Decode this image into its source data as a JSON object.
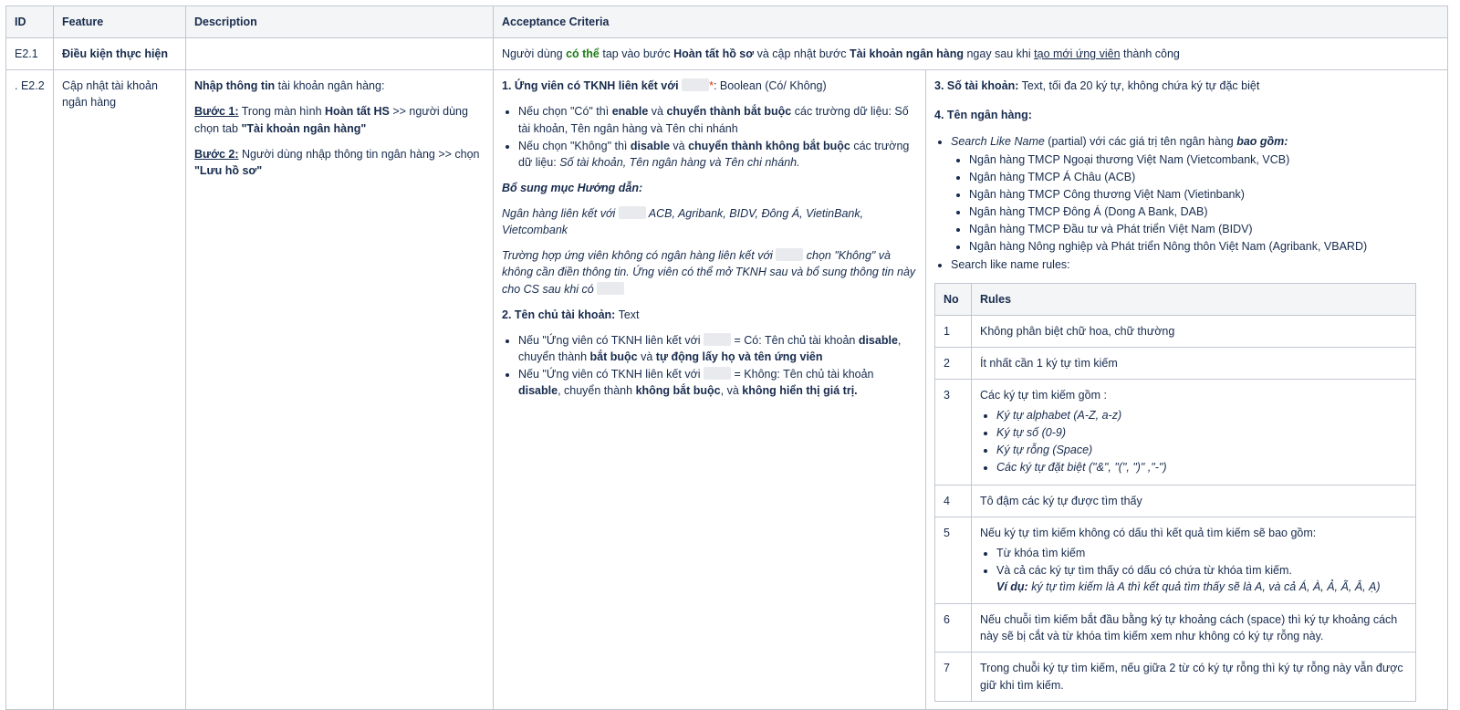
{
  "headers": {
    "id": "ID",
    "feature": "Feature",
    "description": "Description",
    "acceptance": "Acceptance Criteria"
  },
  "row1": {
    "id": "E2.1",
    "feature": "Điều kiện thực hiện",
    "ac": {
      "p1": "Người dùng ",
      "p2": "có thể",
      "p3": " tap vào bước ",
      "p4": "Hoàn tất hồ sơ",
      "p5": " và cập nhật bước ",
      "p6": "Tài khoản ngân hàng",
      "p7": " ngay sau khi ",
      "p8": "tạo mới ứng viên",
      "p9": " thành công"
    }
  },
  "row2": {
    "id": ". E2.2",
    "feature": "Cập nhật tài khoản ngân hàng",
    "desc": {
      "l1b": "Nhập thông tin",
      "l1": " tài khoản ngân hàng:",
      "s1u": "Bước 1:",
      "s1a": " Trong màn hình ",
      "s1b": "Hoàn tất HS",
      "s1c": " >> người dùng chọn tab ",
      "s1d": "\"Tài khoản ngân hàng\"",
      "s2u": "Bước 2:",
      "s2a": " Người dùng nhập thông tin ngân hàng >> chọn ",
      "s2b": "\"Lưu hồ sơ\""
    },
    "c3": {
      "h1a": "1. Ứng viên có TKNH liên kết với ",
      "h1star": "*",
      "h1b": ": Boolean (Có/ Không)",
      "b1a": "Nếu chọn \"Có\" thì ",
      "b1b": "enable",
      "b1c": " và ",
      "b1d": "chuyển thành bắt buộc",
      "b1e": " các trường dữ liệu: Số tài khoản, Tên ngân hàng và Tên chi nhánh",
      "b2a": "Nếu chọn \"Không\" thì ",
      "b2b": "disable",
      "b2c": " và ",
      "b2d": "chuyển thành không bắt buộc",
      "b2e": " các trường dữ liệu: ",
      "b2f": "Số tài khoản, Tên ngân hàng và Tên chi nhánh.",
      "guideTitle": "Bổ sung mục Hướng dẫn:",
      "g1a": "Ngân hàng liên kết với ",
      "g1b": " ACB, Agribank, BIDV, Đông Á, VietinBank, Vietcombank",
      "g2a": "Trường hợp ứng viên không có ngân hàng liên kết với ",
      "g2b": " chọn \"Không\" và không cần điền thông tin. Ứng viên có thể mở TKNH sau và bổ sung thông tin này cho CS sau khi có ",
      "h2a": "2. Tên chủ tài khoản:",
      "h2b": " Text",
      "t1a": "Nếu \"Ứng viên có TKNH liên kết với ",
      "t1b": " = Có: Tên chủ tài khoản ",
      "t1c": "disable",
      "t1d": ", chuyển thành ",
      "t1e": "bắt buộc",
      "t1f": " và ",
      "t1g": "tự động lấy họ và tên ứng viên",
      "t2a": "Nếu \"Ứng viên có TKNH liên kết với ",
      "t2b": " = Không: Tên chủ tài khoản ",
      "t2c": "disable",
      "t2d": ", chuyển thành ",
      "t2e": "không bắt buộc",
      "t2f": ", và ",
      "t2g": "không hiển thị giá trị."
    },
    "c4": {
      "h3a": "3. Số tài khoản:",
      "h3b": " Text, tối đa 20 ký tự, không chứa ký tự đặc biệt",
      "h4": "4. Tên ngân hàng:",
      "sl1": "Search Like Name",
      "sl2": " (partial) với các giá trị tên ngân hàng ",
      "sl3": "bao gồm:",
      "banks": [
        "Ngân hàng TMCP Ngoại thương Việt Nam (Vietcombank, VCB)",
        "Ngân hàng TMCP Á Châu (ACB)",
        "Ngân hàng TMCP Công thương Việt Nam (Vietinbank)",
        "Ngân hàng TMCP Đông Á (Dong A Bank, DAB)",
        "Ngân hàng TMCP Đầu tư và Phát triển Việt Nam (BIDV)",
        "Ngân hàng Nông nghiệp và Phát triển Nông thôn Việt Nam (Agribank, VBARD)"
      ],
      "rulesLabel": "Search like name rules:",
      "rulesHead": {
        "no": "No",
        "rules": "Rules"
      },
      "r1": "Không phân biệt chữ hoa, chữ thường",
      "r2": "Ít nhất cần 1 ký tự tìm kiếm",
      "r3": "Các ký tự tìm kiếm gồm :",
      "r3items": [
        "Ký tự alphabet (A-Z, a-z)",
        "Ký tự số (0-9)",
        "Ký tự rỗng (Space)",
        "Các ký tự đặt biệt (\"&\", \"(\", \")\" ,\"-\")"
      ],
      "r4": "Tô đậm các ký tự được tìm thấy",
      "r5": "Nếu ký tự tìm kiếm không có dấu thì kết quả tìm kiếm sẽ bao gồm:",
      "r5a": "Từ khóa tìm kiếm",
      "r5b": "Và cả các ký tự tìm thấy có dấu có chứa từ khóa tìm kiếm.",
      "r5c": "Ví dụ:",
      "r5d": " ký tự tìm kiếm là A thì kết quả tìm thấy sẽ là A, và cả Á, À, Ả, Ã, Â, Ạ)",
      "r6": "Nếu chuỗi tìm kiếm bắt đầu bằng ký tự khoảng cách (space) thì ký tự khoảng cách này sẽ bị cắt và từ khóa tìm kiếm xem như không có ký tự rỗng này.",
      "r7": "Trong chuỗi ký tự tìm kiếm, nếu giữa 2 từ có ký tự rỗng thì ký tự rỗng này vẫn được giữ khi tìm kiếm.",
      "nums": [
        "1",
        "2",
        "3",
        "4",
        "5",
        "6",
        "7"
      ]
    }
  }
}
